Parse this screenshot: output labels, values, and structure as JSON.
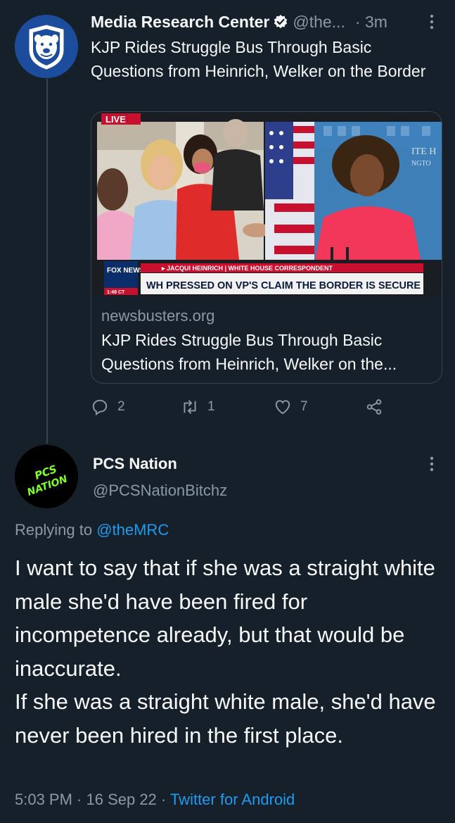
{
  "tweet1": {
    "display_name": "Media Research Center",
    "verified_icon": "verified-badge-icon",
    "handle": "@the...",
    "time": "· 3m",
    "text": "KJP Rides Struggle Bus Through Basic Questions from Heinrich, Welker on the Border",
    "card": {
      "live_badge": "LIVE",
      "network_logo": "FOX NEWS",
      "clock": "1:48 CT",
      "lower_third_sub": "▸ JACQUI HEINRICH | WHITE HOUSE CORRESPONDENT",
      "lower_third_main": "WH PRESSED ON VP'S CLAIM THE BORDER IS SECURE",
      "domain": "newsbusters.org",
      "title": "KJP Rides Struggle Bus Through Basic Questions from Heinrich, Welker on the..."
    },
    "actions": {
      "reply_count": "2",
      "retweet_count": "1",
      "like_count": "7"
    }
  },
  "tweet2": {
    "display_name": "PCS Nation",
    "handle": "@PCSNationBitchz",
    "avatar_text_1": "PCS",
    "avatar_text_2": "NATION",
    "replying_prefix": "Replying to ",
    "replying_mention": "@theMRC",
    "text_line_1": "I want to say that if she was a straight white male she'd have been fired for incompetence already, but that would be inaccurate.",
    "text_line_2": "If she was a straight white male, she'd have never been hired in the first place.",
    "time": "5:03 PM · 16 Sep 22 · ",
    "source": "Twitter for Android"
  },
  "colors": {
    "background": "#15202b",
    "secondary_text": "#8b98a5",
    "link": "#1d9bf0",
    "divider": "#38444d",
    "fox_red": "#c8102e"
  }
}
